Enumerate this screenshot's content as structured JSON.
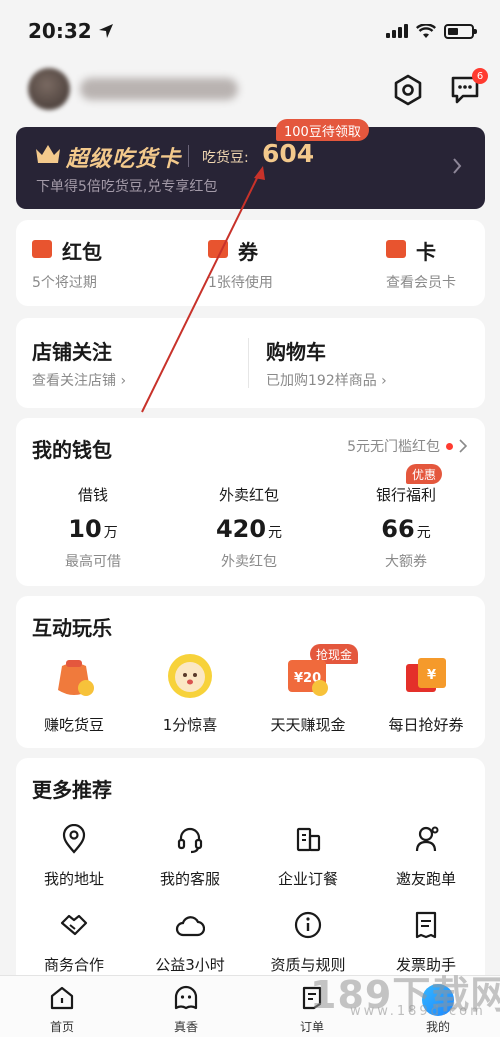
{
  "status_bar": {
    "time": "20:32",
    "icons": [
      "location-arrow-icon",
      "signal-icon",
      "wifi-icon",
      "battery-icon"
    ]
  },
  "header": {
    "settings_icon": "settings-hexagon-icon",
    "messages_icon": "chat-icon",
    "message_badge": "6"
  },
  "super_card": {
    "title": "超级吃货卡",
    "bean_label": "吃货豆:",
    "bean_value": "604",
    "claim_tag": "100豆待领取",
    "subtitle": "下单得5倍吃货豆,兑专享红包"
  },
  "quick_links": [
    {
      "title": "红包",
      "sub": "5个将过期"
    },
    {
      "title": "券",
      "sub": "1张待使用"
    },
    {
      "title": "卡",
      "sub": "查看会员卡"
    }
  ],
  "store_row": [
    {
      "title": "店铺关注",
      "sub": "查看关注店铺 ›"
    },
    {
      "title": "购物车",
      "sub": "已加购192样商品 ›"
    }
  ],
  "wallet": {
    "title": "我的钱包",
    "link": "5元无门槛红包",
    "offer_tag": "优惠",
    "items": [
      {
        "label": "借钱",
        "value": "10",
        "unit": "万",
        "sub": "最高可借"
      },
      {
        "label": "外卖红包",
        "value": "420",
        "unit": "元",
        "sub": "外卖红包"
      },
      {
        "label": "银行福利",
        "value": "66",
        "unit": "元",
        "sub": "大额券"
      }
    ]
  },
  "fun": {
    "title": "互动玩乐",
    "cash_tag": "抢现金",
    "items": [
      {
        "label": "赚吃货豆",
        "icon": "bean-bag-icon"
      },
      {
        "label": "1分惊喜",
        "icon": "surprise-face-icon"
      },
      {
        "label": "天天赚现金",
        "icon": "cash-coupon-icon"
      },
      {
        "label": "每日抢好券",
        "icon": "ticket-icon"
      }
    ],
    "coupon_text": "¥20"
  },
  "more": {
    "title": "更多推荐",
    "items": [
      {
        "label": "我的地址",
        "icon": "location-pin-icon"
      },
      {
        "label": "我的客服",
        "icon": "headset-icon"
      },
      {
        "label": "企业订餐",
        "icon": "building-icon"
      },
      {
        "label": "邀友跑单",
        "icon": "rider-icon"
      },
      {
        "label": "商务合作",
        "icon": "handshake-icon"
      },
      {
        "label": "公益3小时",
        "icon": "cloud-icon"
      },
      {
        "label": "资质与规则",
        "icon": "info-icon"
      },
      {
        "label": "发票助手",
        "icon": "invoice-icon"
      }
    ]
  },
  "tabs": [
    {
      "label": "首页",
      "icon": "home-icon"
    },
    {
      "label": "真香",
      "icon": "smile-icon"
    },
    {
      "label": "订单",
      "icon": "order-icon"
    },
    {
      "label": "我的",
      "icon": "profile-icon"
    }
  ],
  "watermark": {
    "main": "189下载网",
    "sub": "www.189d.com"
  },
  "colors": {
    "accent": "#e4573d",
    "card_dark": "#282436",
    "gold": "#f3c98c",
    "annotation_arrow": "#c8322a"
  }
}
